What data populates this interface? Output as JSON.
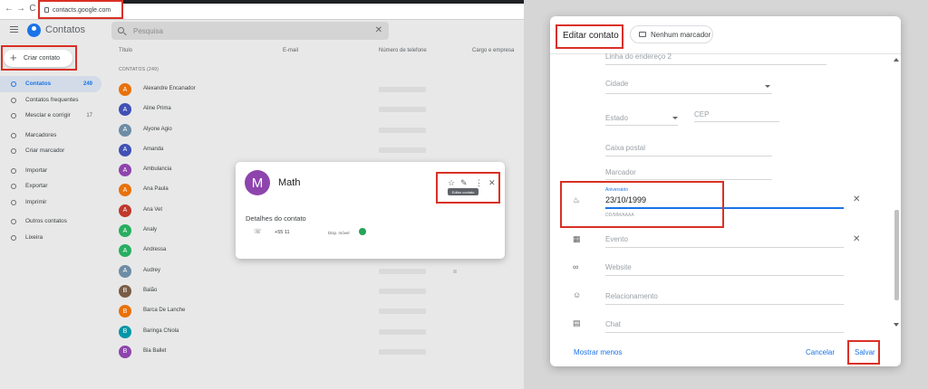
{
  "browser": {
    "back": "←",
    "forward": "→",
    "reload": "C",
    "url": "contacts.google.com"
  },
  "app": {
    "title": "Contatos",
    "search_placeholder": "Pesquisa",
    "create_label": "Criar contato",
    "nav": [
      {
        "label": "Contatos",
        "count": "249",
        "active": true
      },
      {
        "label": "Contatos frequentes",
        "count": ""
      },
      {
        "label": "Mesclar e corrigir",
        "count": "17"
      },
      {
        "label": "Marcadores",
        "count": ""
      },
      {
        "label": "Criar marcador",
        "count": ""
      },
      {
        "label": "Importar",
        "count": ""
      },
      {
        "label": "Exportar",
        "count": ""
      },
      {
        "label": "Imprimir",
        "count": ""
      },
      {
        "label": "Outros contatos",
        "count": ""
      },
      {
        "label": "Lixeira",
        "count": ""
      }
    ],
    "columns": [
      "Título",
      "E-mail",
      "Número de telefone",
      "Cargo e empresa"
    ],
    "section_label": "CONTATOS (249)",
    "contacts": [
      {
        "initial": "A",
        "name": "Alexandre Encanador",
        "color": "#e8710a"
      },
      {
        "initial": "A",
        "name": "Aline Prima",
        "color": "#3f51b5"
      },
      {
        "initial": "A",
        "name": "Alyone Agio",
        "color": "#6d8ca5"
      },
      {
        "initial": "A",
        "name": "Amanda",
        "color": "#3f51b5"
      },
      {
        "initial": "A",
        "name": "Ambulancia",
        "color": "#8e44ad"
      },
      {
        "initial": "A",
        "name": "Ana Paula",
        "color": "#e8710a"
      },
      {
        "initial": "A",
        "name": "Ana Vet",
        "color": "#c0392b"
      },
      {
        "initial": "A",
        "name": "Analy",
        "color": "#27ae60"
      },
      {
        "initial": "A",
        "name": "Andressa",
        "color": "#27ae60"
      },
      {
        "initial": "A",
        "name": "Audrey",
        "color": "#6d8ca5"
      },
      {
        "initial": "B",
        "name": "Balão",
        "color": "#7a5c45"
      },
      {
        "initial": "B",
        "name": "Barca De Lanche",
        "color": "#e8710a"
      },
      {
        "initial": "B",
        "name": "Baringa Chiola",
        "color": "#0097a7"
      },
      {
        "initial": "B",
        "name": "Bia Ballet",
        "color": "#8e44ad"
      }
    ]
  },
  "popup": {
    "avatar_initial": "M",
    "name": "Math",
    "star": "☆",
    "edit": "✎",
    "more": "⋮",
    "close": "✕",
    "tooltip": "Editar contato",
    "details_title": "Detalhes do contato",
    "phone_icon": "phone-icon",
    "phone": "+55 11",
    "phone_type": "Disp. móvel"
  },
  "dialog": {
    "title": "Editar contato",
    "label_chip": "Nenhum marcador",
    "fields": {
      "address2": "Linha do endereço 2",
      "city": "Cidade",
      "state": "Estado",
      "zip": "CEP",
      "pobox": "Caixa postal",
      "marker": "Marcador",
      "birthday_label": "Aniversário",
      "birthday_value": "23/10/1999",
      "birthday_hint": "DD/MM/AAAA",
      "event": "Evento",
      "website": "Website",
      "relationship": "Relacionamento",
      "chat": "Chat"
    },
    "footer": {
      "show_less": "Mostrar menos",
      "cancel": "Cancelar",
      "save": "Salvar"
    }
  },
  "highlight_color": "#d93025",
  "accent_color": "#1a73e8"
}
